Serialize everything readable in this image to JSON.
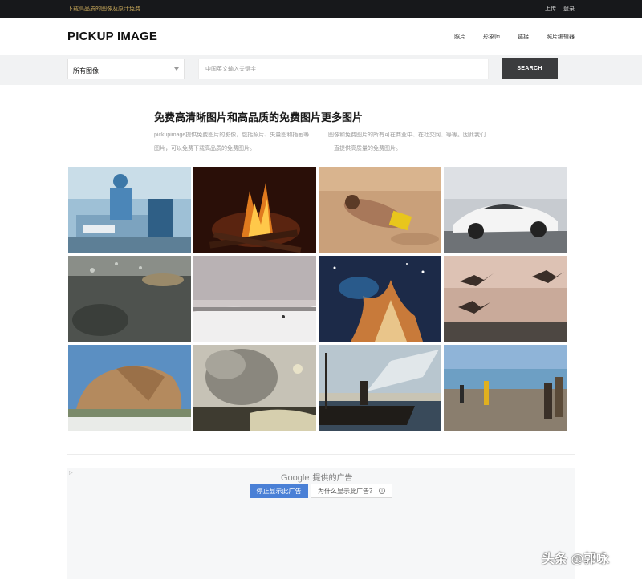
{
  "topbar": {
    "tagline": "下载高品质的图像及原汁免费",
    "links": [
      "上传",
      "登录"
    ]
  },
  "header": {
    "logo": "PICKUP IMAGE",
    "nav": [
      "照片",
      "形象师",
      "链接",
      "照片编辑器"
    ]
  },
  "search": {
    "category": "所有图像",
    "placeholder": "中国英文输入关键字",
    "button": "SEARCH"
  },
  "intro": {
    "headline": "免费高清晰图片和高品质的免费图片更多图片",
    "left_text": "pickupimage提供免费图片的影像，包括照片、矢量图和插画等图片，可以免费下载高品质的免费图片。",
    "right_text": "图像和免费图片的所有可在商业中、在社交网、等等。因此我们一直提供高质量的免费图片。"
  },
  "gallery": {
    "colors": {
      "accent_dark": "#3b3c3e",
      "ad_blue": "#4a80d6",
      "topbar": "#17181b"
    },
    "tiles": [
      {
        "name": "surgery-photo"
      },
      {
        "name": "campfire-photo"
      },
      {
        "name": "beach-woman-photo"
      },
      {
        "name": "white-sports-car-photo"
      },
      {
        "name": "underwater-fish-photo"
      },
      {
        "name": "snowy-field-photo"
      },
      {
        "name": "nebula-space-photo"
      },
      {
        "name": "flying-birds-photo"
      },
      {
        "name": "boulder-rock-photo"
      },
      {
        "name": "geyser-smoke-photo"
      },
      {
        "name": "fisherman-net-photo"
      },
      {
        "name": "beach-people-photo"
      }
    ]
  },
  "ad": {
    "provider": "Google",
    "title_suffix": "提供的广告",
    "stop_button": "停止显示此广告",
    "why_button": "为什么显示此广告？",
    "info_glyph": "i",
    "mark": "▷"
  },
  "watermark": "头条 @郭咏"
}
